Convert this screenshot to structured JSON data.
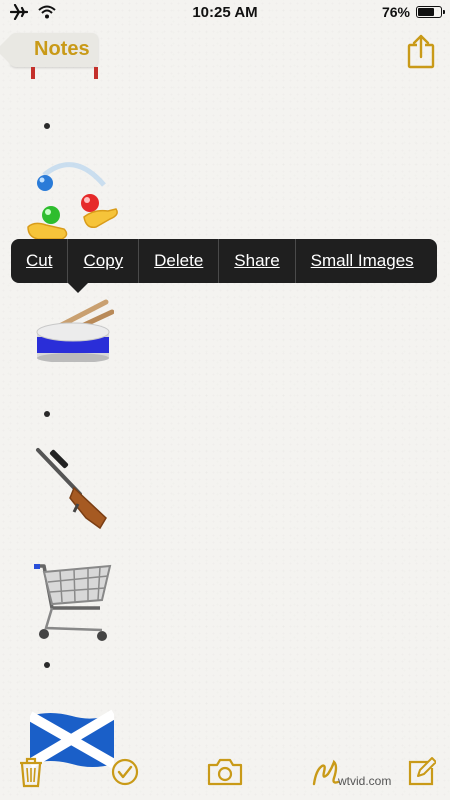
{
  "status_bar": {
    "time": "10:25 AM",
    "battery_percent": "76%",
    "battery_level": 0.76
  },
  "nav": {
    "back_label": "Notes"
  },
  "context_menu": {
    "items": [
      "Cut",
      "Copy",
      "Delete",
      "Share",
      "Small Images"
    ]
  },
  "note_items": [
    {
      "kind": "bullet"
    },
    {
      "kind": "emoji",
      "icon": "juggling-hands-emoji"
    },
    {
      "kind": "emoji",
      "icon": "drum-emoji"
    },
    {
      "kind": "bullet"
    },
    {
      "kind": "emoji",
      "icon": "rifle-emoji"
    },
    {
      "kind": "emoji",
      "icon": "shopping-cart-emoji"
    },
    {
      "kind": "bullet"
    },
    {
      "kind": "emoji",
      "icon": "scotland-flag-emoji"
    }
  ],
  "toolbar": {
    "icons": [
      "trash-icon",
      "checklist-icon",
      "camera-icon",
      "sketch-icon",
      "compose-icon"
    ]
  },
  "watermark": "wtvid.com",
  "colors": {
    "accent": "#c99a18",
    "menu_bg": "#1f1f1f",
    "background": "#f4f3f0"
  }
}
